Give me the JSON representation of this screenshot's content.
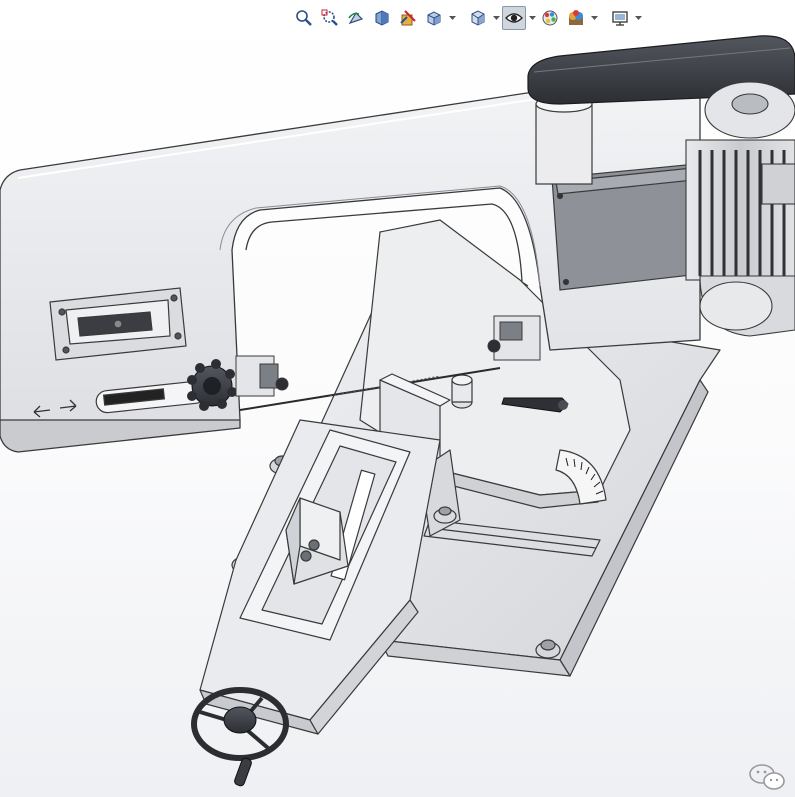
{
  "view": {
    "background_top": "#ffffff",
    "background_bottom": "#eef0f3"
  },
  "heads_up_toolbar": {
    "items": [
      {
        "icon": "zoom-to-fit-icon"
      },
      {
        "icon": "zoom-to-area-icon"
      },
      {
        "icon": "previous-view-icon"
      },
      {
        "icon": "section-view-icon"
      },
      {
        "icon": "dynamic-annotation-views-icon"
      },
      {
        "icon": "view-orientation-icon",
        "has_dropdown": true
      },
      {
        "icon": "display-style-icon",
        "has_dropdown": true
      },
      {
        "icon": "hide-show-items-icon",
        "has_dropdown": true,
        "active": true
      },
      {
        "icon": "edit-appearance-icon"
      },
      {
        "icon": "apply-scene-icon",
        "has_dropdown": true
      },
      {
        "icon": "view-settings-icon",
        "has_dropdown": true
      }
    ]
  },
  "model": {
    "name_shown": "",
    "part_color": "#e6e7ea",
    "edge_color": "#3a3a3a",
    "motor_color": "#d5d7da",
    "belt_cover_color": "#3c3f44"
  },
  "watermark": {
    "icon": "wechat-logo-icon"
  }
}
